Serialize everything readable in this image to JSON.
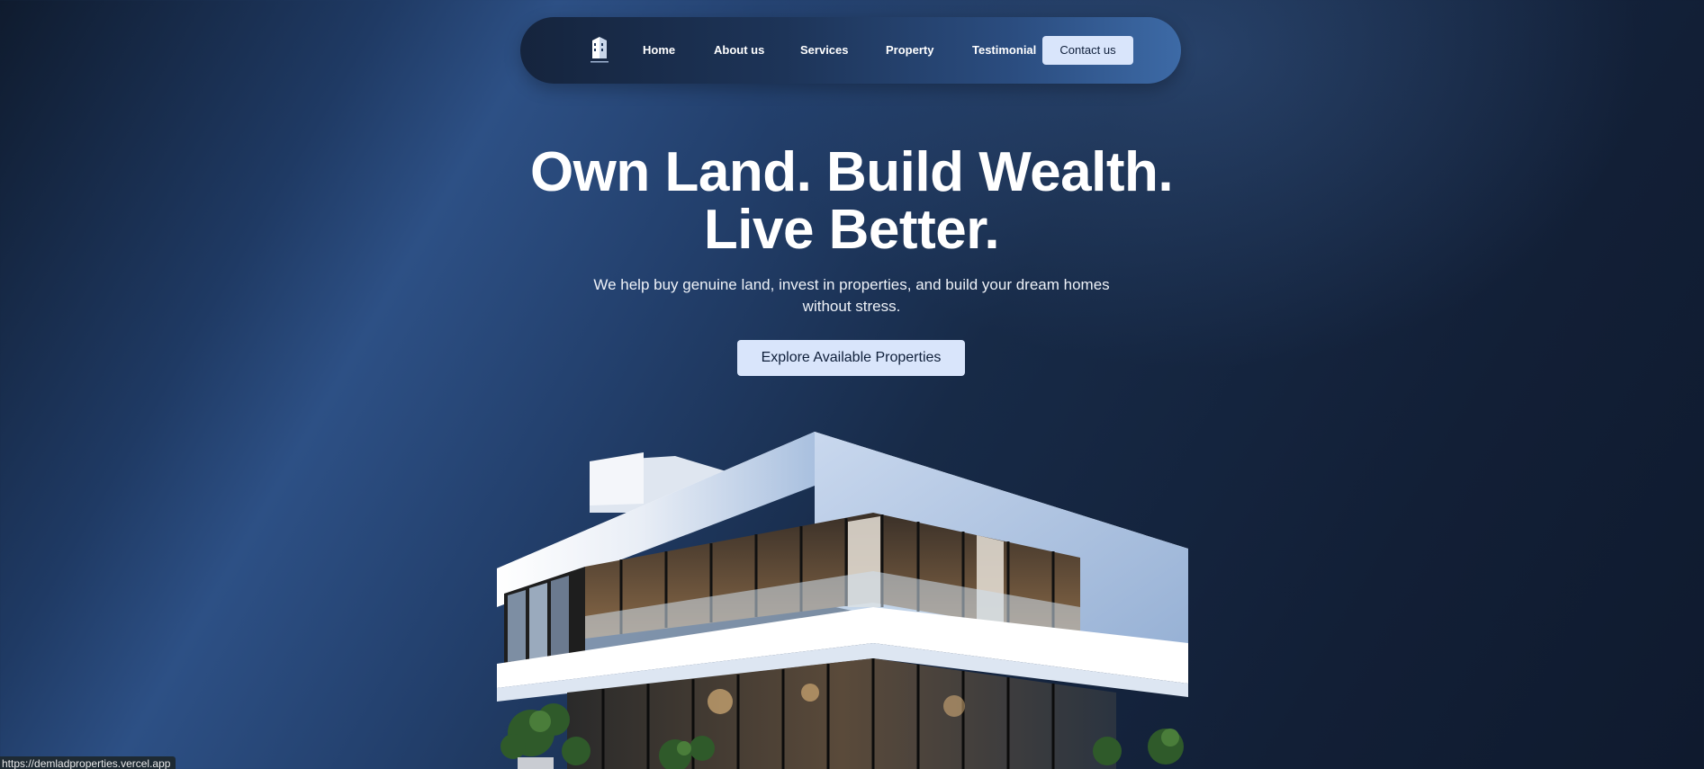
{
  "nav": {
    "logo_icon": "building-logo-icon",
    "links": [
      "Home",
      "About us",
      "Services",
      "Property",
      "Testimonial"
    ],
    "contact_label": "Contact us"
  },
  "hero": {
    "title_line1": "Own Land. Build Wealth.",
    "title_line2": "Live Better.",
    "subtitle": "We help buy genuine land, invest in properties, and build your dream homes without stress.",
    "cta_label": "Explore Available Properties"
  },
  "status_bar": {
    "url": "https://demladproperties.vercel.app"
  },
  "colors": {
    "accent_button": "#d9e5fb",
    "button_text": "#0f1f3a",
    "background_dark": "#121f36",
    "background_highlight": "#2d5085"
  }
}
